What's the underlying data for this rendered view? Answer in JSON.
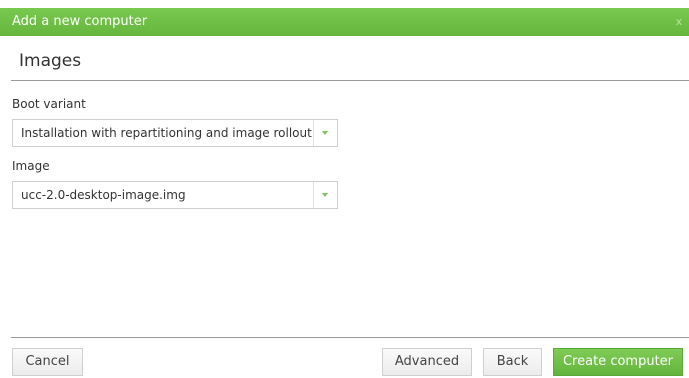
{
  "dialog": {
    "title": "Add a new computer",
    "close_glyph": "x",
    "close_icon": "close-icon"
  },
  "section": {
    "heading": "Images"
  },
  "boot_variant": {
    "label": "Boot variant",
    "selected": "Installation with repartitioning and image rollout",
    "icon": "chevron-down-icon"
  },
  "image": {
    "label": "Image",
    "selected": "ucc-2.0-desktop-image.img",
    "icon": "chevron-down-icon"
  },
  "buttons": {
    "cancel": "Cancel",
    "advanced": "Advanced",
    "back": "Back",
    "create": "Create computer"
  },
  "colors": {
    "accent": "#6ebe44",
    "primary_button": "#6dbd45",
    "dropdown_arrow": "#7cc35a"
  }
}
